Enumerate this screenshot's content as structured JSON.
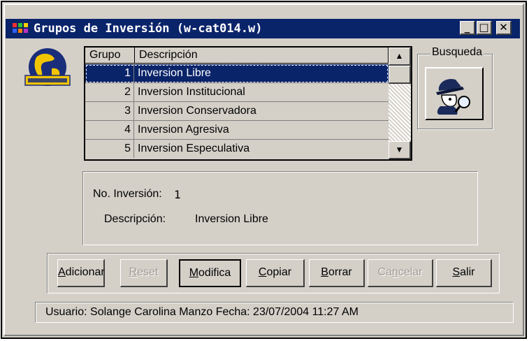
{
  "window": {
    "title": "Grupos de Inversión  (w-cat014.w)",
    "controls": {
      "minimize": "_",
      "maximize": "□",
      "close": "✕"
    }
  },
  "grid": {
    "columns": [
      "Grupo",
      "Descripción"
    ],
    "rows": [
      {
        "grupo": "1",
        "descripcion": "Inversion Libre",
        "selected": true
      },
      {
        "grupo": "2",
        "descripcion": "Inversion Institucional"
      },
      {
        "grupo": "3",
        "descripcion": "Inversion Conservadora"
      },
      {
        "grupo": "4",
        "descripcion": "Inversion Agresiva"
      },
      {
        "grupo": "5",
        "descripcion": "Inversion Especulativa"
      }
    ]
  },
  "search": {
    "label": "Busqueda",
    "icon": "detective-magnifier-icon"
  },
  "detail": {
    "no_label": "No. Inversión:",
    "no_value": "1",
    "desc_label": "Descripción:",
    "desc_value": "Inversion Libre"
  },
  "buttons": {
    "adicionar": {
      "accel": "A",
      "rest": "dicionar",
      "enabled": true
    },
    "reset": {
      "accel": "R",
      "rest": "eset",
      "enabled": false
    },
    "modifica": {
      "accel": "M",
      "rest": "odifica",
      "enabled": true
    },
    "copiar": {
      "accel": "C",
      "rest": "opiar",
      "enabled": true
    },
    "borrar": {
      "accel": "B",
      "rest": "orrar",
      "enabled": true
    },
    "cancelar_pre": "Ca",
    "cancelar_accel": "n",
    "cancelar_post": "celar",
    "salir": {
      "accel": "S",
      "rest": "alir",
      "enabled": true
    }
  },
  "status": "Usuario: Solange Carolina Manzo   Fecha: 23/07/2004 11:27 AM",
  "colors": {
    "titlebar": "#0a246a",
    "face": "#d4d0c8",
    "selection": "#0a246a"
  }
}
